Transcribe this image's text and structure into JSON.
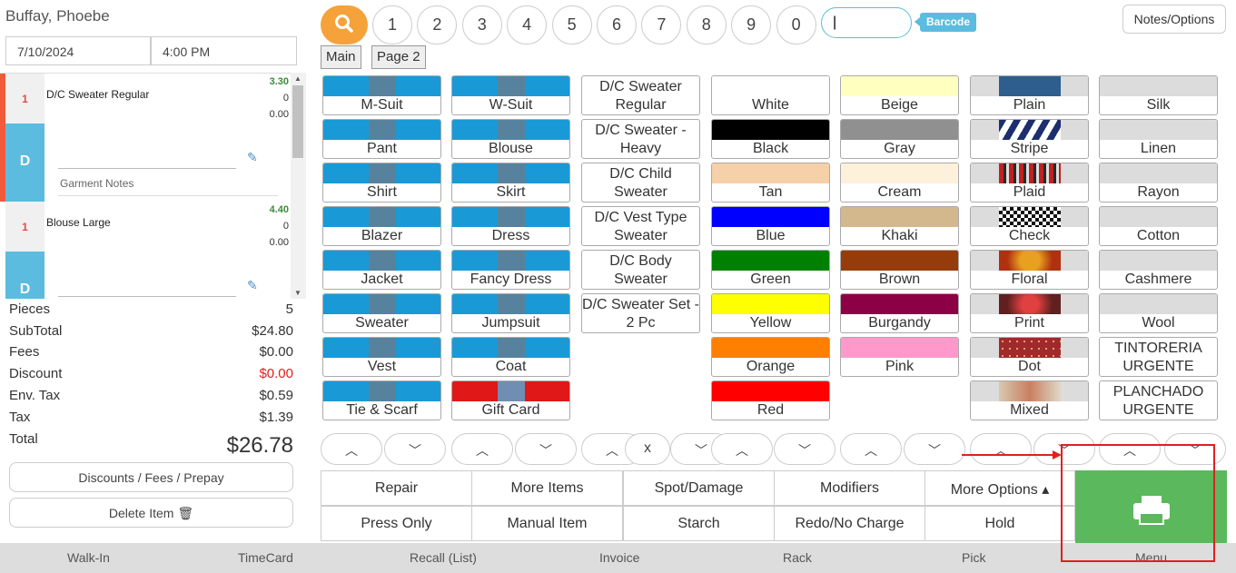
{
  "customer": "Buffay, Phoebe",
  "date": "7/10/2024",
  "time": "4:00 PM",
  "garments": [
    {
      "qty": "1",
      "name": "D/C Sweater Regular",
      "price": "3.30",
      "line2": "0",
      "line3": "0.00",
      "code": "D",
      "notes_label": "Garment Notes"
    },
    {
      "qty": "1",
      "name": "Blouse Large",
      "price": "4.40",
      "line2": "0",
      "line3": "0.00",
      "code": "D"
    }
  ],
  "totals": {
    "pieces_label": "Pieces",
    "pieces": "5",
    "subtotal_label": "SubTotal",
    "subtotal": "$24.80",
    "fees_label": "Fees",
    "fees": "$0.00",
    "discount_label": "Discount",
    "discount": "$0.00",
    "envtax_label": "Env. Tax",
    "envtax": "$0.59",
    "tax_label": "Tax",
    "tax": "$1.39",
    "total_label": "Total",
    "total": "$26.78"
  },
  "left_buttons": {
    "discounts": "Discounts / Fees / Prepay",
    "delete": "Delete Item"
  },
  "numpad": [
    "1",
    "2",
    "3",
    "4",
    "5",
    "6",
    "7",
    "8",
    "9",
    "0"
  ],
  "barcode_label": "Barcode",
  "notes_options": "Notes/Options",
  "tabs": [
    "Main",
    "Page 2"
  ],
  "items": [
    "M-Suit",
    "W-Suit",
    "Pant",
    "Blouse",
    "Shirt",
    "Skirt",
    "Blazer",
    "Dress",
    "Jacket",
    "Fancy Dress",
    "Sweater",
    "Jumpsuit",
    "Vest",
    "Coat",
    "Tie & Scarf",
    "Gift Card"
  ],
  "dc_items": [
    "D/C Sweater Regular",
    "D/C Sweater - Heavy",
    "D/C Child Sweater",
    "D/C Vest Type Sweater",
    "D/C Body Sweater",
    "D/C Sweater Set - 2 Pc"
  ],
  "colors1": [
    {
      "name": "White",
      "hex": "#ffffff"
    },
    {
      "name": "Black",
      "hex": "#000000"
    },
    {
      "name": "Tan",
      "hex": "#f5d0a9"
    },
    {
      "name": "Blue",
      "hex": "#0000ff"
    },
    {
      "name": "Green",
      "hex": "#008000"
    },
    {
      "name": "Yellow",
      "hex": "#ffff00"
    },
    {
      "name": "Orange",
      "hex": "#ff8000"
    },
    {
      "name": "Red",
      "hex": "#ff0000"
    }
  ],
  "colors2": [
    {
      "name": "Beige",
      "hex": "#ffffc0"
    },
    {
      "name": "Gray",
      "hex": "#909090"
    },
    {
      "name": "Cream",
      "hex": "#fdf1dc"
    },
    {
      "name": "Khaki",
      "hex": "#d2b88c"
    },
    {
      "name": "Brown",
      "hex": "#963c0a"
    },
    {
      "name": "Burgandy",
      "hex": "#8c0046"
    },
    {
      "name": "Pink",
      "hex": "#ff99cc"
    }
  ],
  "patterns": [
    "Plain",
    "Stripe",
    "Plaid",
    "Check",
    "Floral",
    "Print",
    "Dot",
    "Mixed"
  ],
  "fabrics": [
    "Silk",
    "Linen",
    "Rayon",
    "Cotton",
    "Cashmere",
    "Wool",
    "TINTORERIA URGENTE",
    "PLANCHADO URGENTE"
  ],
  "arrow_x": "x",
  "actions_row1": [
    "Repair",
    "More Items",
    "Spot/Damage",
    "Modifiers",
    "More Options ▴"
  ],
  "actions_row2": [
    "Press Only",
    "Manual Item",
    "Starch",
    "Redo/No Charge",
    "Hold"
  ],
  "bottom_nav": [
    "Walk-In",
    "TimeCard",
    "Recall (List)",
    "Invoice",
    "Rack",
    "Pick",
    "Menu"
  ]
}
